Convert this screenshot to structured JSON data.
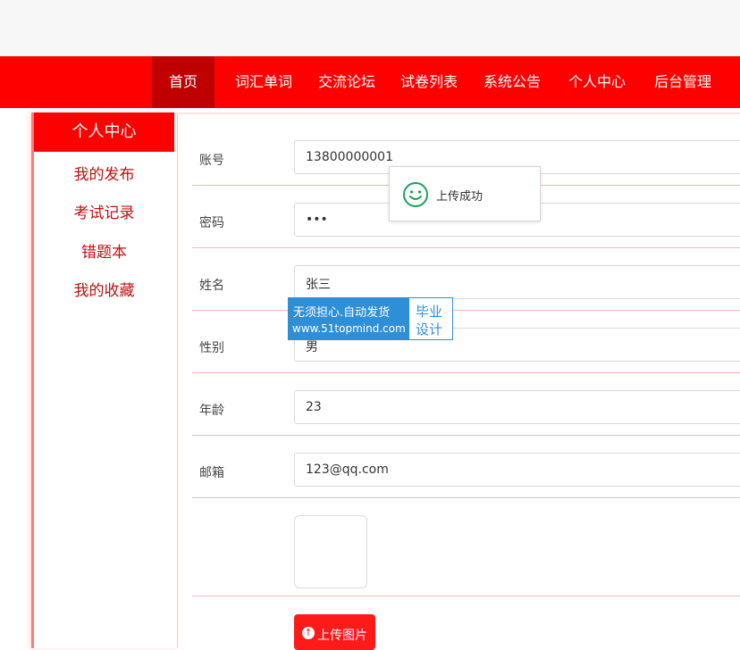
{
  "nav": {
    "items": [
      {
        "label": "首页",
        "active": true
      },
      {
        "label": "词汇单词"
      },
      {
        "label": "交流论坛"
      },
      {
        "label": "试卷列表"
      },
      {
        "label": "系统公告"
      },
      {
        "label": "个人中心"
      },
      {
        "label": "后台管理"
      }
    ]
  },
  "sidebar": {
    "title": "个人中心",
    "items": [
      "我的发布",
      "考试记录",
      "错题本",
      "我的收藏"
    ]
  },
  "form": {
    "account_label": "账号",
    "account_value": "13800000001",
    "password_label": "密码",
    "password_value": "•••",
    "name_label": "姓名",
    "name_value": "张三",
    "gender_label": "性别",
    "gender_value": "男",
    "age_label": "年龄",
    "age_value": "23",
    "email_label": "邮箱",
    "email_value": "123@qq.com",
    "upload_label": "上传图片"
  },
  "toast": {
    "message": "上传成功",
    "icon": "smile-icon"
  },
  "watermark": {
    "line1": "无须担心.自动发货",
    "line2": "www.51topmind.com",
    "right1": "毕业",
    "right2": "设计"
  },
  "colors": {
    "primary": "#ff0000",
    "active": "#bf0000",
    "sidebar_text": "#c01010",
    "toast_icon": "#1aa35a",
    "watermark": "#2f8fd6"
  }
}
